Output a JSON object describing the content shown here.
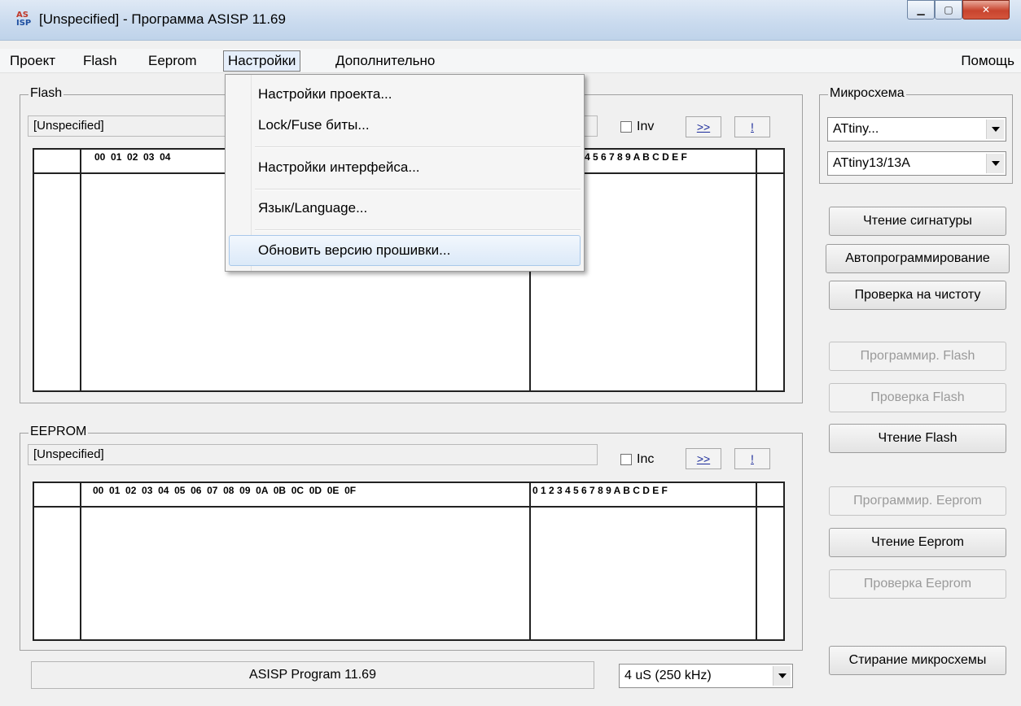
{
  "window": {
    "title": "[Unspecified] - Программа ASISP 11.69",
    "icon_top": "AS",
    "icon_bottom": "ISP",
    "icons": [
      "minimize-icon",
      "maximize-icon",
      "close-icon"
    ]
  },
  "menubar": {
    "items": [
      "Проект",
      "Flash",
      "Eeprom",
      "Настройки",
      "Дополнительно"
    ],
    "help": "Помощь",
    "active": "Настройки"
  },
  "settings_menu": {
    "items": [
      "Настройки проекта...",
      "Lock/Fuse биты...",
      "Настройки интерфейса...",
      "Язык/Language...",
      "Обновить версию прошивки..."
    ],
    "highlighted": "Обновить версию прошивки..."
  },
  "flash": {
    "legend": "Flash",
    "file": "[Unspecified]",
    "checkbox_label": "Inv",
    "checked": false,
    "nav_label": ">>",
    "run_label": "!",
    "hex_header": "00  01  02  03  04",
    "ascii_header": "4 5 6 7 8 9 A B C D E F"
  },
  "eeprom": {
    "legend": "EEPROM",
    "file": "[Unspecified]",
    "checkbox_label": "Inc",
    "checked": false,
    "nav_label": ">>",
    "run_label": "!",
    "hex_header": "00  01  02  03  04  05  06  07  08  09  0A  0B  0C  0D  0E  0F",
    "ascii_header": "0 1 2 3 4 5 6 7 8 9 A B C D E F"
  },
  "chip": {
    "legend": "Микросхема",
    "family": "ATtiny...",
    "model": "ATtiny13/13A"
  },
  "actions": {
    "read_signature": "Чтение сигнатуры",
    "auto_program": "Автопрограммирование",
    "blank_check": "Проверка на чистоту",
    "program_flash": "Программир. Flash",
    "verify_flash": "Проверка Flash",
    "read_flash": "Чтение Flash",
    "program_eeprom": "Программир. Eeprom",
    "read_eeprom": "Чтение Eeprom",
    "verify_eeprom": "Проверка Eeprom",
    "erase_chip": "Стирание микросхемы"
  },
  "status": {
    "text": "ASISP Program 11.69",
    "speed": "4 uS  (250 kHz)"
  }
}
